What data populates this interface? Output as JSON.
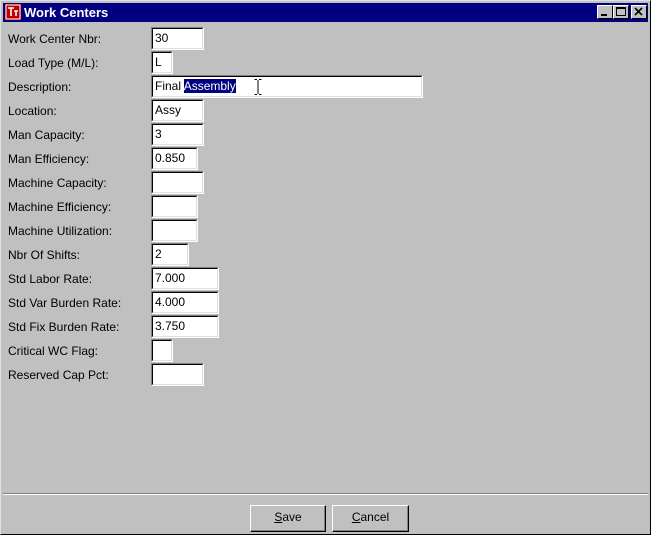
{
  "window": {
    "title": "Work Centers",
    "controls": [
      "minimize",
      "maximize",
      "close"
    ]
  },
  "form": {
    "fields": [
      {
        "label": "Work Center Nbr:",
        "value": "30"
      },
      {
        "label": "Load Type (M/L):",
        "value": "L"
      },
      {
        "label": "Description:",
        "value_plain": "Final ",
        "value_selected": "Assembly"
      },
      {
        "label": "Location:",
        "value": "Assy"
      },
      {
        "label": "Man Capacity:",
        "value": "3"
      },
      {
        "label": "Man Efficiency:",
        "value": "0.850"
      },
      {
        "label": "Machine Capacity:",
        "value": ""
      },
      {
        "label": "Machine Efficiency:",
        "value": ""
      },
      {
        "label": "Machine Utilization:",
        "value": ""
      },
      {
        "label": "Nbr Of Shifts:",
        "value": "2"
      },
      {
        "label": "Std Labor Rate:",
        "value": "7.000"
      },
      {
        "label": "Std Var Burden Rate:",
        "value": "4.000"
      },
      {
        "label": "Std Fix Burden Rate:",
        "value": "3.750"
      },
      {
        "label": "Critical WC Flag:",
        "value": ""
      },
      {
        "label": "Reserved Cap Pct:",
        "value": ""
      }
    ]
  },
  "buttons": {
    "save": {
      "first": "S",
      "rest": "ave"
    },
    "cancel": {
      "first": "C",
      "rest": "ancel"
    }
  },
  "colors": {
    "titlebar": "#000080",
    "face": "#c0c0c0",
    "selection": "#000080"
  }
}
